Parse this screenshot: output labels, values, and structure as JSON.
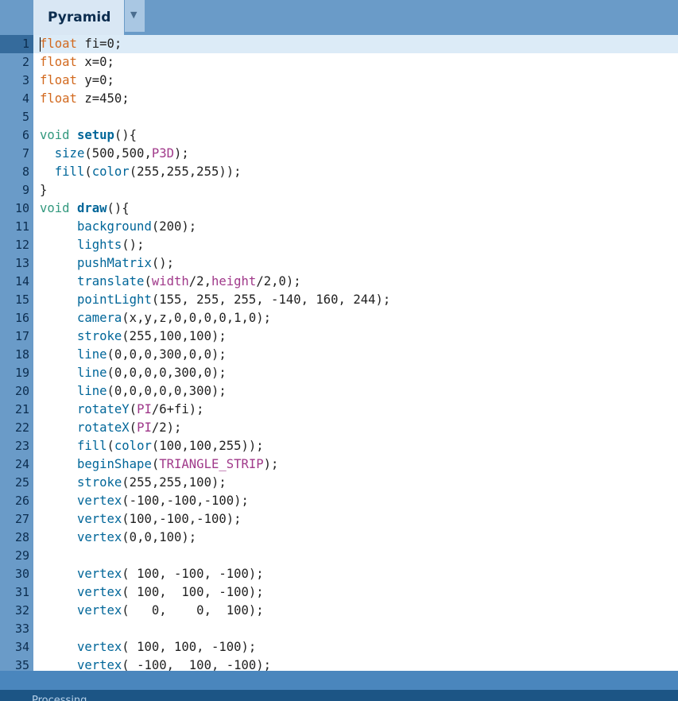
{
  "tab": {
    "title": "Pyramid",
    "menu_icon": "triangle-down-icon"
  },
  "editor": {
    "lines": [
      "float fi=0;",
      "float x=0;",
      "float y=0;",
      "float z=450;",
      "",
      "void setup(){",
      "  size(500,500,P3D);",
      "  fill(color(255,255,255));",
      "}",
      "void draw(){",
      "     background(200);",
      "     lights();",
      "     pushMatrix();",
      "     translate(width/2,height/2,0);",
      "     pointLight(155, 255, 255, -140, 160, 244);",
      "     camera(x,y,z,0,0,0,0,1,0);",
      "     stroke(255,100,100);",
      "     line(0,0,0,300,0,0);",
      "     line(0,0,0,0,300,0);",
      "     line(0,0,0,0,0,300);",
      "     rotateY(PI/6+fi);",
      "     rotateX(PI/2);",
      "     fill(color(100,100,255));",
      "     beginShape(TRIANGLE_STRIP);",
      "     stroke(255,255,100);",
      "     vertex(-100,-100,-100);",
      "     vertex(100,-100,-100);",
      "     vertex(0,0,100);",
      "",
      "     vertex( 100, -100, -100);",
      "     vertex( 100,  100, -100);",
      "     vertex(   0,    0,  100);",
      "",
      "     vertex( 100, 100, -100);",
      "     vertex( -100,  100, -100);"
    ],
    "active_line": 1
  },
  "status": {
    "text": "Processing"
  },
  "colors": {
    "tab_bar": "#6a9bc8",
    "gutter": "#6a9bc8",
    "active_line": "#dcebf7",
    "keyword_type": "#d2691e",
    "keyword_function": "#006699",
    "constant": "#a0398a",
    "status_bar": "#1c5585"
  }
}
